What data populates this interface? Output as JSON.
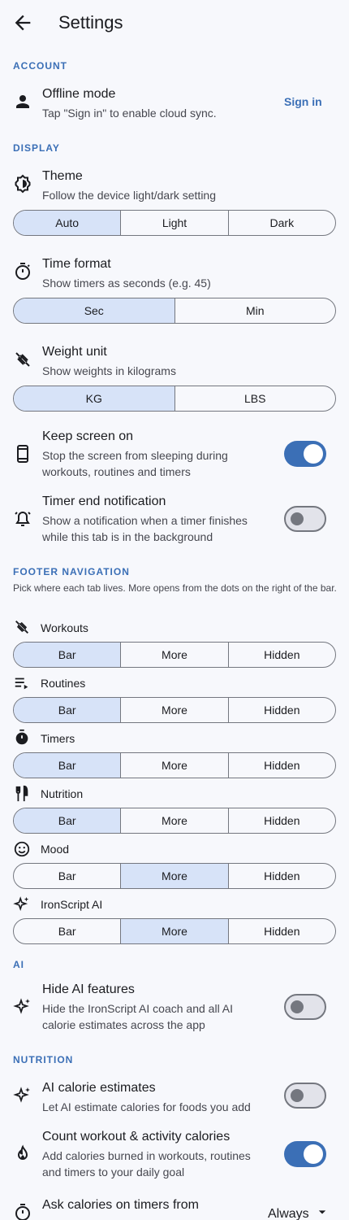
{
  "header": {
    "title": "Settings"
  },
  "sections": {
    "account": "ACCOUNT",
    "display": "DISPLAY",
    "footer": "FOOTER NAVIGATION",
    "ai": "AI",
    "nutrition": "NUTRITION"
  },
  "account": {
    "title": "Offline mode",
    "desc": "Tap \"Sign in\" to enable cloud sync.",
    "signin": "Sign in"
  },
  "theme": {
    "title": "Theme",
    "desc": "Follow the device light/dark setting",
    "options": [
      "Auto",
      "Light",
      "Dark"
    ],
    "selected": "Auto"
  },
  "timeformat": {
    "title": "Time format",
    "desc": "Show timers as seconds (e.g. 45)",
    "options": [
      "Sec",
      "Min"
    ],
    "selected": "Sec"
  },
  "weight": {
    "title": "Weight unit",
    "desc": "Show weights in kilograms",
    "options": [
      "KG",
      "LBS"
    ],
    "selected": "KG"
  },
  "keepscreen": {
    "title": "Keep screen on",
    "desc": "Stop the screen from sleeping during workouts, routines and timers",
    "on": true
  },
  "timerend": {
    "title": "Timer end notification",
    "desc": "Show a notification when a timer finishes while this tab is in the background",
    "on": false
  },
  "footer": {
    "note": "Pick where each tab lives. More opens from the dots on the right of the bar.",
    "options": [
      "Bar",
      "More",
      "Hidden"
    ],
    "items": [
      {
        "label": "Workouts",
        "icon": "dumbbell-icon",
        "selected": "Bar"
      },
      {
        "label": "Routines",
        "icon": "playlist-icon",
        "selected": "Bar"
      },
      {
        "label": "Timers",
        "icon": "stopwatch-icon",
        "selected": "Bar"
      },
      {
        "label": "Nutrition",
        "icon": "fork-knife-icon",
        "selected": "Bar"
      },
      {
        "label": "Mood",
        "icon": "smiley-icon",
        "selected": "More"
      },
      {
        "label": "IronScript AI",
        "icon": "sparkle-icon",
        "selected": "More"
      }
    ]
  },
  "hideai": {
    "title": "Hide AI features",
    "desc": "Hide the IronScript AI coach and all AI calorie estimates across the app",
    "on": false
  },
  "aicalorie": {
    "title": "AI calorie estimates",
    "desc": "Let AI estimate calories for foods you add",
    "on": false
  },
  "countcal": {
    "title": "Count workout & activity calories",
    "desc": "Add calories burned in workouts, routines and timers to your daily goal",
    "on": true
  },
  "askcal": {
    "title": "Ask calories on timers from",
    "value": "Always"
  },
  "colors": {
    "accent": "#3b6fb6",
    "selected_segment": "#d7e3f8",
    "background": "#f7f8fc"
  }
}
